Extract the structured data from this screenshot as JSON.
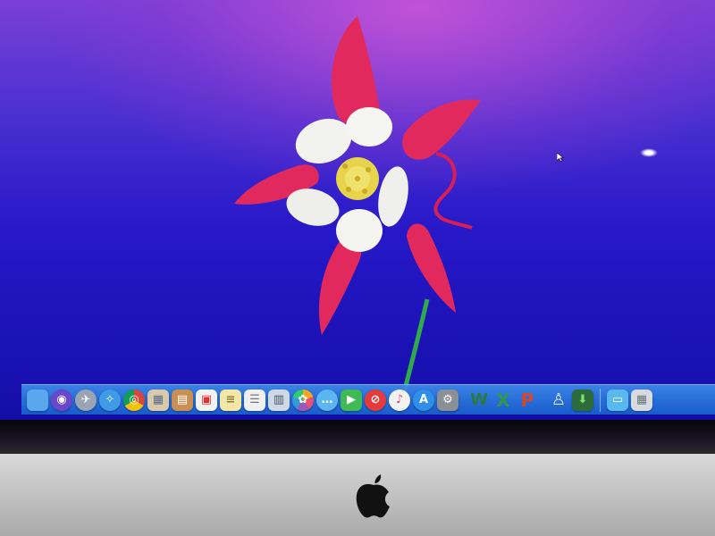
{
  "desktop": {
    "wallpaper": "columbine flower",
    "colors": {
      "background_top": "#7a3fd6",
      "background_bottom": "#140ea8",
      "petal": "#e2295e",
      "sepal": "#f2f2ee",
      "stem": "#2eaa4a"
    }
  },
  "dock": {
    "apps": [
      {
        "icon": "finder-icon",
        "color": "#5aa7ee",
        "glyph": ""
      },
      {
        "icon": "siri-icon",
        "color": "#6a46c9",
        "glyph": "◉"
      },
      {
        "icon": "launchpad-icon",
        "color": "#9aa5b3",
        "glyph": "✈"
      },
      {
        "icon": "safari-icon",
        "color": "#3f9be6",
        "glyph": "✧"
      },
      {
        "icon": "chrome-icon",
        "color": "#e6b422",
        "glyph": "◎"
      },
      {
        "icon": "photo-viewer-icon",
        "color": "#d9c9a8",
        "glyph": "▦"
      },
      {
        "icon": "contacts-icon",
        "color": "#c98f55",
        "glyph": "▤"
      },
      {
        "icon": "calendar-icon",
        "color": "#f2f2f2",
        "glyph": "▣"
      },
      {
        "icon": "notes-icon",
        "color": "#f3e7a6",
        "glyph": "≡"
      },
      {
        "icon": "reminders-icon",
        "color": "#f0f0f0",
        "glyph": "☰"
      },
      {
        "icon": "preview-icon",
        "color": "#cfd9e6",
        "glyph": "▥"
      },
      {
        "icon": "photos-icon",
        "color": "#f4f4f4",
        "glyph": "✿"
      },
      {
        "icon": "messages-icon",
        "color": "#5bb6f0",
        "glyph": "…"
      },
      {
        "icon": "facetime-icon",
        "color": "#3fba55",
        "glyph": "▶"
      },
      {
        "icon": "blocked-icon",
        "color": "#e53b3b",
        "glyph": "⊘"
      },
      {
        "icon": "itunes-icon",
        "color": "#f2f2f2",
        "glyph": "♪"
      },
      {
        "icon": "app-store-icon",
        "color": "#2f8fe8",
        "glyph": "A"
      },
      {
        "icon": "system-preferences-icon",
        "color": "#8b8f96",
        "glyph": "⚙"
      },
      {
        "icon": "word-icon",
        "color": "#2a7a3a",
        "glyph": "W"
      },
      {
        "icon": "excel-icon",
        "color": "#2e9a4a",
        "glyph": "X"
      },
      {
        "icon": "powerpoint-icon",
        "color": "#d9452b",
        "glyph": "P"
      },
      {
        "icon": "utility-icon",
        "color": "#4a8fd8",
        "glyph": "♙"
      },
      {
        "icon": "downloads-icon",
        "color": "#2d6b3c",
        "glyph": "⬇"
      }
    ],
    "stack_items": [
      {
        "icon": "folder-icon",
        "color": "#59b8ef",
        "glyph": "▭"
      },
      {
        "icon": "trash-icon",
        "color": "#d7dbe0",
        "glyph": "▦"
      }
    ]
  },
  "monitor": {
    "logo": "apple-logo-icon"
  }
}
